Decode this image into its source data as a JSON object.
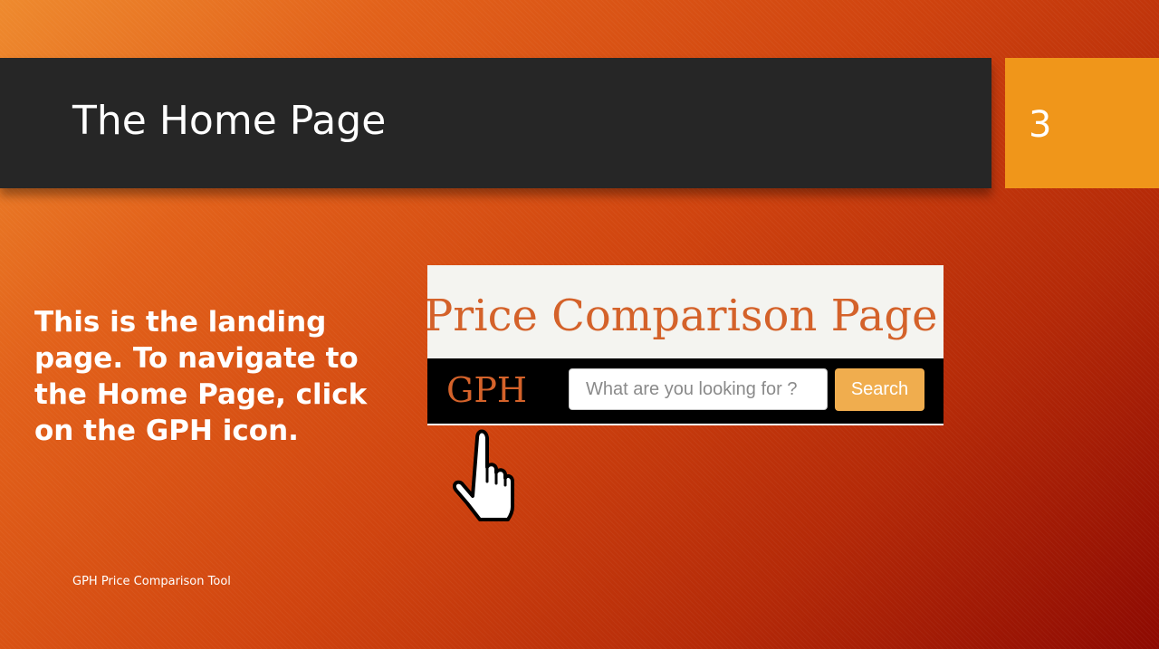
{
  "slide": {
    "title": "The Home Page",
    "number": "3",
    "body": "This is the landing page. To navigate to the Home Page, click on the GPH icon.",
    "footer": "GPH Price Comparison Tool"
  },
  "website": {
    "heading": "Price Comparison Page",
    "brand": "GPH",
    "search": {
      "placeholder": "What are you looking for ?",
      "value": "",
      "button_label": "Search"
    }
  },
  "icons": {
    "pointer": "hand-pointer-icon"
  },
  "colors": {
    "title_bar": "#262626",
    "slide_number_box": "#f0961a",
    "heading": "#d4622a",
    "nav_background": "#000000",
    "search_button": "#f0ad4e"
  }
}
